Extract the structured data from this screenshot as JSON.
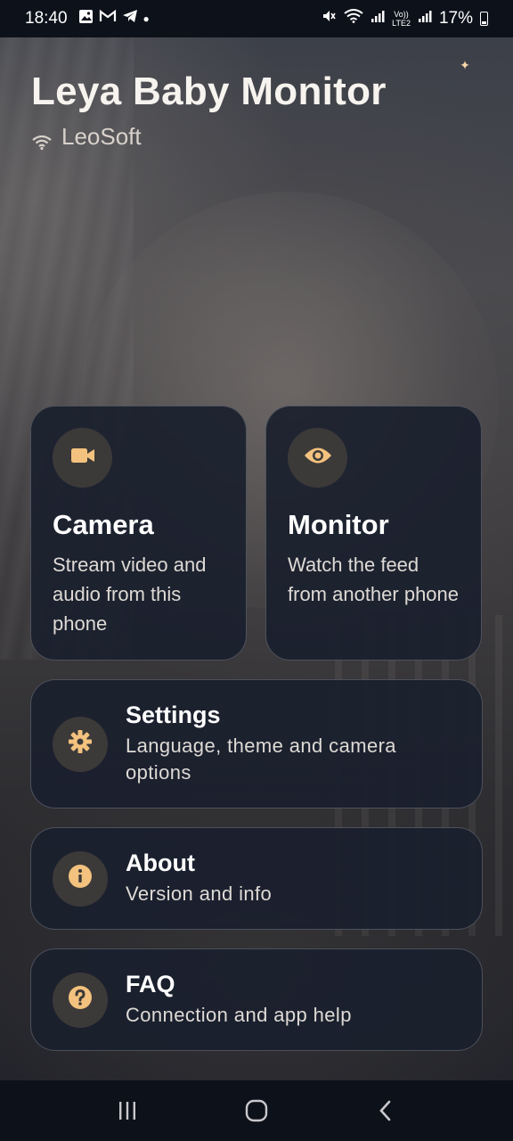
{
  "status_bar": {
    "time": "18:40",
    "battery": "17%",
    "notifications": [
      "image-icon",
      "gmail-icon",
      "telegram-icon",
      "dot"
    ],
    "indicators": [
      "mute-icon",
      "wifi-icon",
      "signal-icon",
      "volte-icon",
      "signal-icon"
    ]
  },
  "header": {
    "title": "Leya Baby Monitor",
    "vendor": "LeoSoft"
  },
  "cards": {
    "camera": {
      "title": "Camera",
      "desc": "Stream video and audio from this phone",
      "icon": "video-camera-icon"
    },
    "monitor": {
      "title": "Monitor",
      "desc": "Watch the feed from another phone",
      "icon": "eye-icon"
    },
    "settings": {
      "title": "Settings",
      "desc": "Language, theme and camera options",
      "icon": "gear-icon"
    },
    "about": {
      "title": "About",
      "desc": "Version and info",
      "icon": "info-icon"
    },
    "faq": {
      "title": "FAQ",
      "desc": "Connection and app help",
      "icon": "help-icon"
    }
  },
  "colors": {
    "accent": "#f3c27e",
    "card_bg": "#1a202e",
    "icon_circle": "#3c3a39"
  },
  "navbar": [
    "recent-apps-icon",
    "home-icon",
    "back-icon"
  ]
}
